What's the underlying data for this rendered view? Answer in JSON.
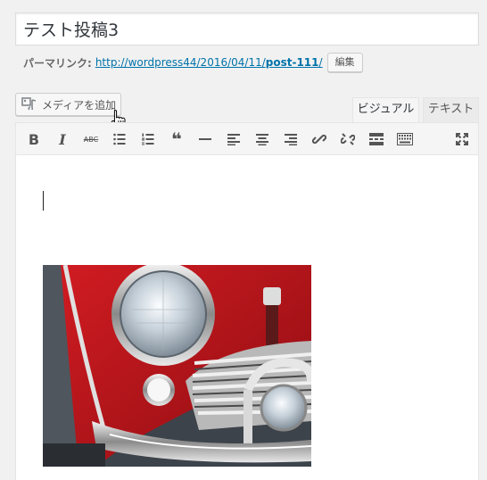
{
  "post": {
    "title": "テスト投稿3"
  },
  "permalink": {
    "label": "パーマリンク:",
    "url_prefix": "http://wordpress44/2016/04/11/",
    "slug": "post-111",
    "url_suffix": "/",
    "edit_label": "編集"
  },
  "media": {
    "add_label": "メディアを追加"
  },
  "editor_tabs": {
    "visual": "ビジュアル",
    "text": "テキスト"
  },
  "toolbar": {
    "bold_label": "B",
    "italic_label": "I",
    "strike_label": "ABC",
    "quote_label": "❝",
    "icons": [
      "bold-icon",
      "italic-icon",
      "strikethrough-icon",
      "bullet-list-icon",
      "numbered-list-icon",
      "blockquote-icon",
      "horizontal-line-icon",
      "align-left-icon",
      "align-center-icon",
      "align-right-icon",
      "insert-link-icon",
      "remove-link-icon",
      "read-more-icon",
      "toolbar-toggle-icon",
      "fullscreen-icon"
    ]
  },
  "colors": {
    "link": "#0073aa",
    "car_red": "#c0141a"
  }
}
